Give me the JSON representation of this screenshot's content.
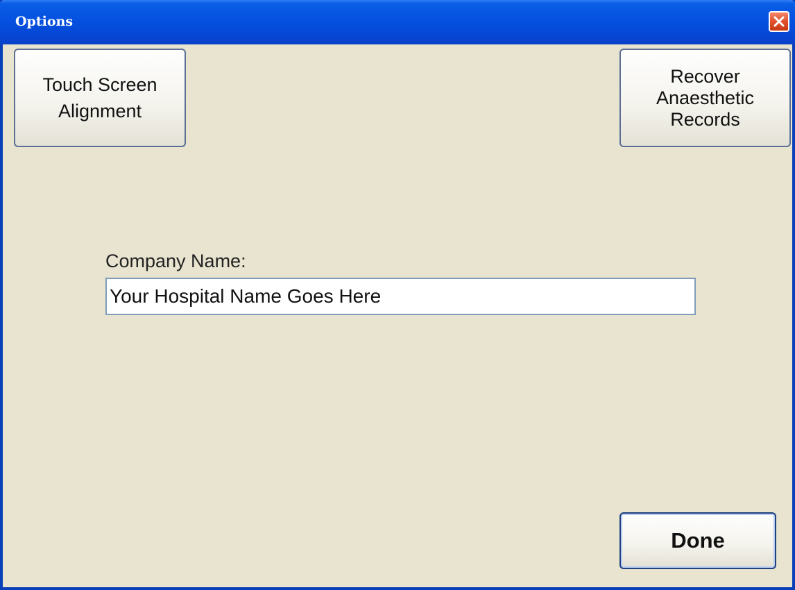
{
  "window": {
    "title": "Options",
    "close_icon": "close-icon"
  },
  "buttons": {
    "touch_screen": "Touch Screen\nAlignment",
    "recover": "Recover\nAnaesthetic\nRecords",
    "done": "Done"
  },
  "company": {
    "label": "Company Name:",
    "value": "Your Hospital Name Goes Here"
  },
  "colors": {
    "titlebar": "#0551e0",
    "window_bg": "#e8e4d0",
    "close_button": "#e3512e"
  }
}
